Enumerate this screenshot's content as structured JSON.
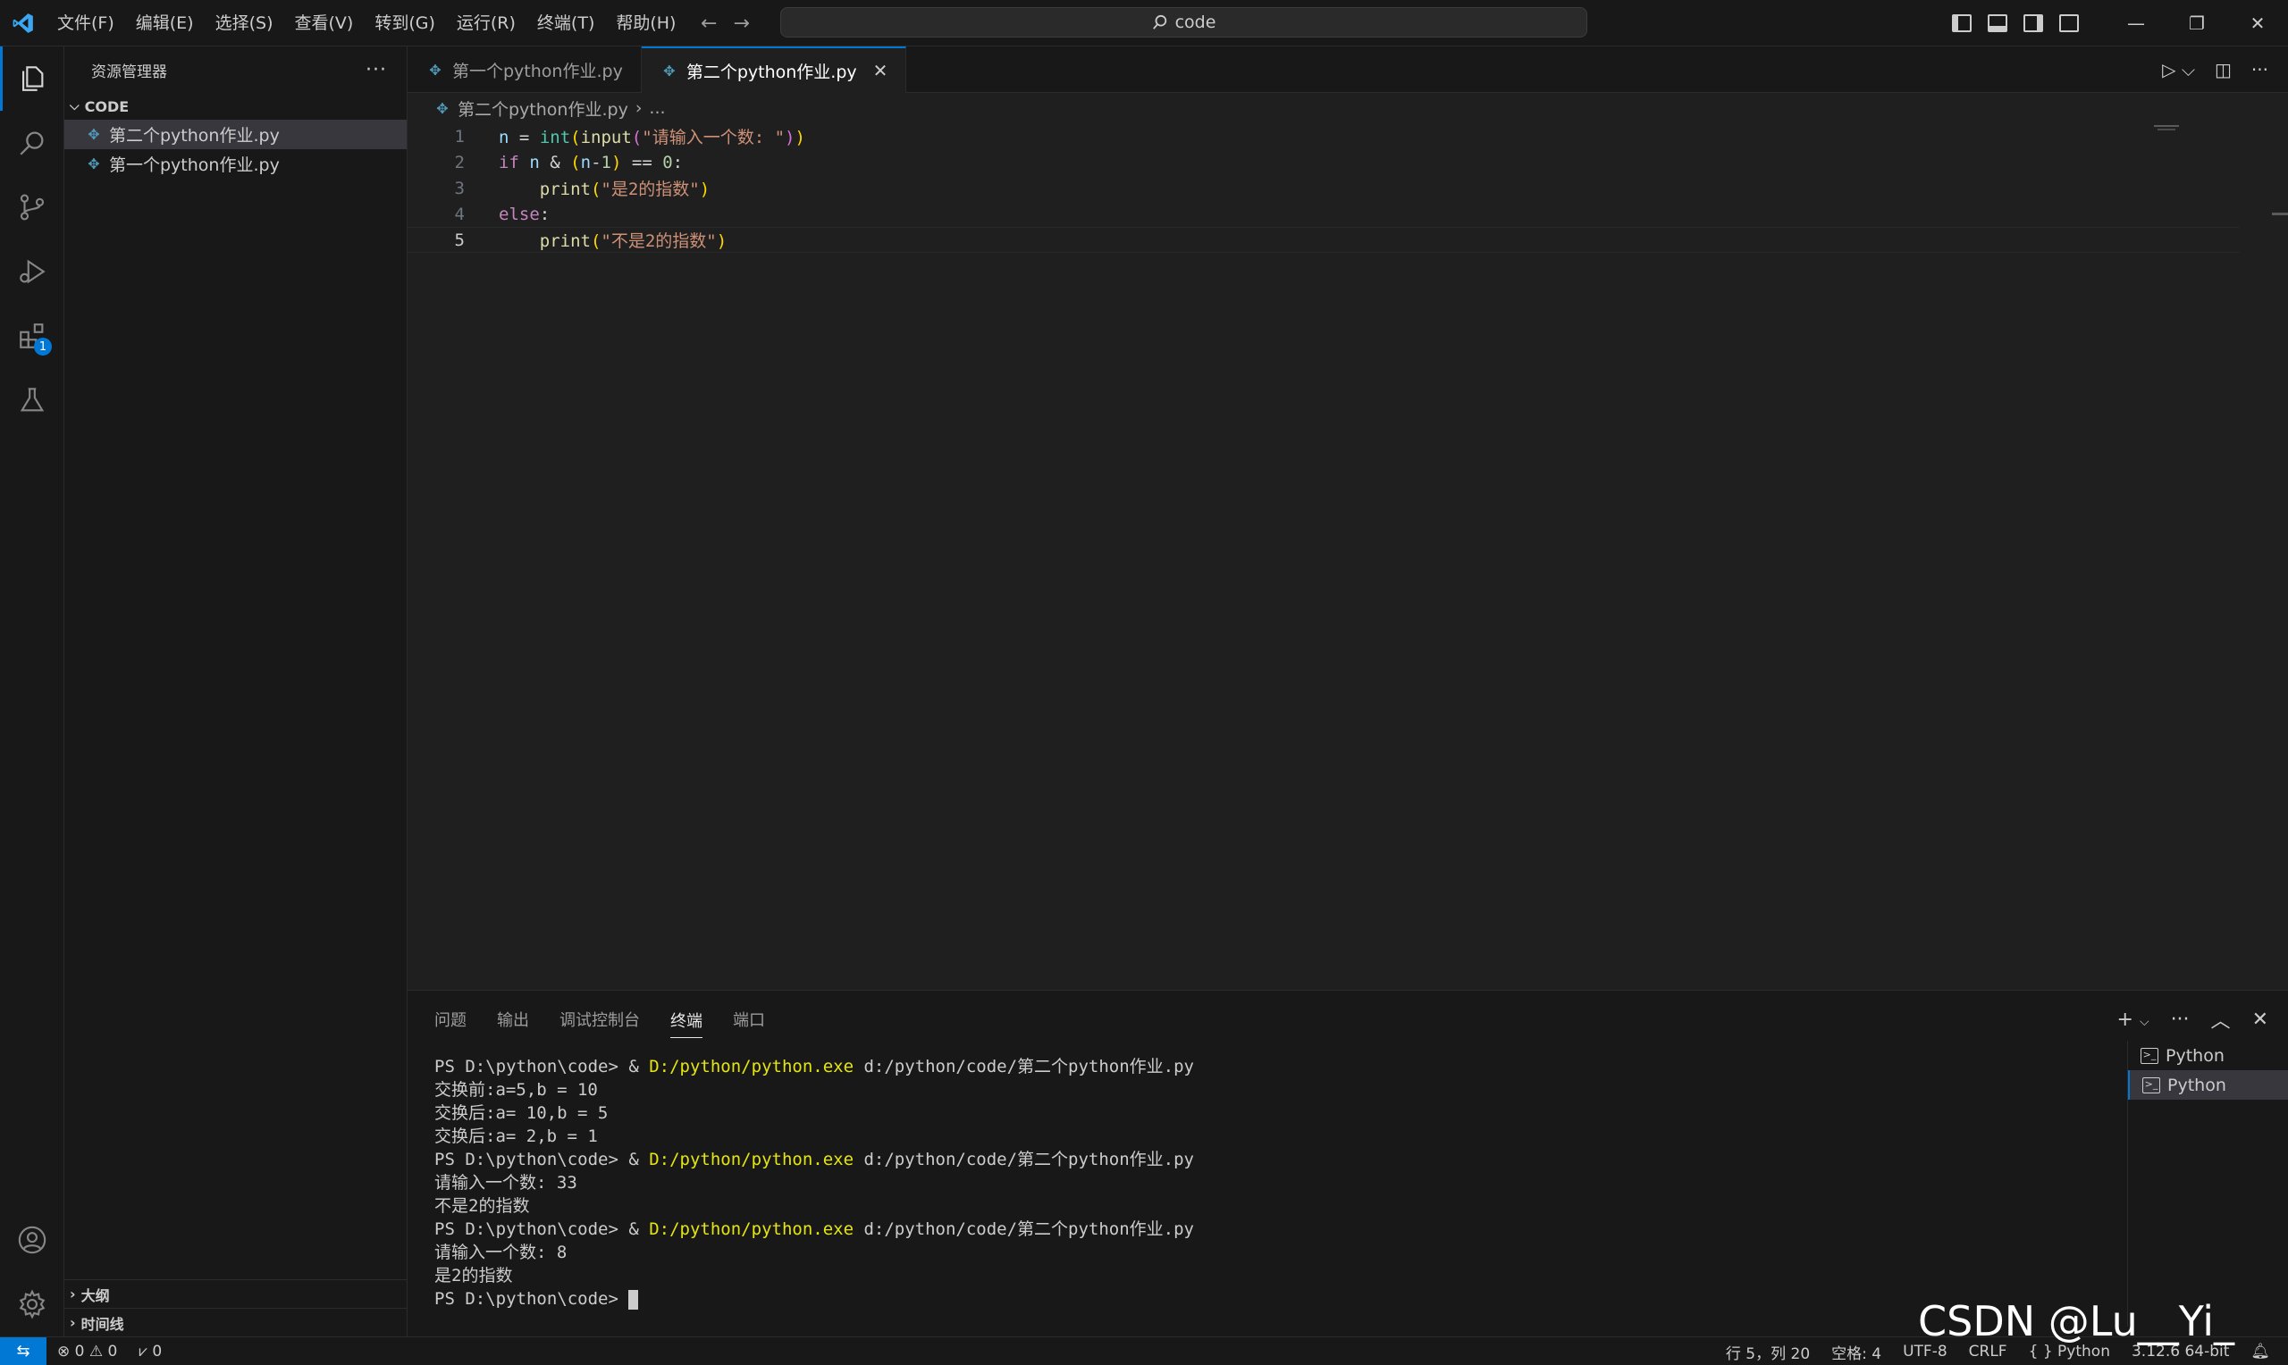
{
  "menu": [
    "文件(F)",
    "编辑(E)",
    "选择(S)",
    "查看(V)",
    "转到(G)",
    "运行(R)",
    "终端(T)",
    "帮助(H)"
  ],
  "command_center": "code",
  "activity": {
    "extensions_badge": "1"
  },
  "sidebar": {
    "title": "资源管理器",
    "folder": "CODE",
    "files": [
      "第二个python作业.py",
      "第一个python作业.py"
    ],
    "outline": "大纲",
    "timeline": "时间线"
  },
  "tabs": [
    {
      "label": "第一个python作业.py"
    },
    {
      "label": "第二个python作业.py"
    }
  ],
  "breadcrumb": {
    "file": "第二个python作业.py",
    "more": "..."
  },
  "line_numbers": [
    "1",
    "2",
    "3",
    "4",
    "5"
  ],
  "code_lines": [
    "n = int(input(\"请输入一个数: \"))",
    "if n & (n-1) == 0:",
    "    print(\"是2的指数\")",
    "else:",
    "    print(\"不是2的指数\")"
  ],
  "panel": {
    "tabs": [
      "问题",
      "输出",
      "调试控制台",
      "终端",
      "端口"
    ],
    "active_tab": "终端",
    "terminals": [
      "Python",
      "Python"
    ]
  },
  "terminal": {
    "prompt": "PS D:\\python\\code> ",
    "amp": "& ",
    "exe": "D:/python/python.exe",
    "script": " d:/python/code/第二个python作业.py",
    "lines": [
      "交换前:a=5,b = 10",
      "交换后:a= 10,b = 5",
      "交换后:a= 2,b = 1",
      "请输入一个数: 33",
      "不是2的指数",
      "请输入一个数: 8",
      "是2的指数"
    ]
  },
  "status": {
    "errors": "0",
    "warnings": "0",
    "ports": "0",
    "position": "行 5，列 20",
    "spaces": "空格: 4",
    "encoding": "UTF-8",
    "eol": "CRLF",
    "braces": "{ }",
    "language": "Python",
    "interpreter": "3.12.6 64-bit"
  },
  "watermark": "CSDN @Lu__Yi_",
  "colors": {
    "accent": "#0078d4",
    "editor_bg": "#1f1f1f",
    "chrome_bg": "#181818"
  }
}
